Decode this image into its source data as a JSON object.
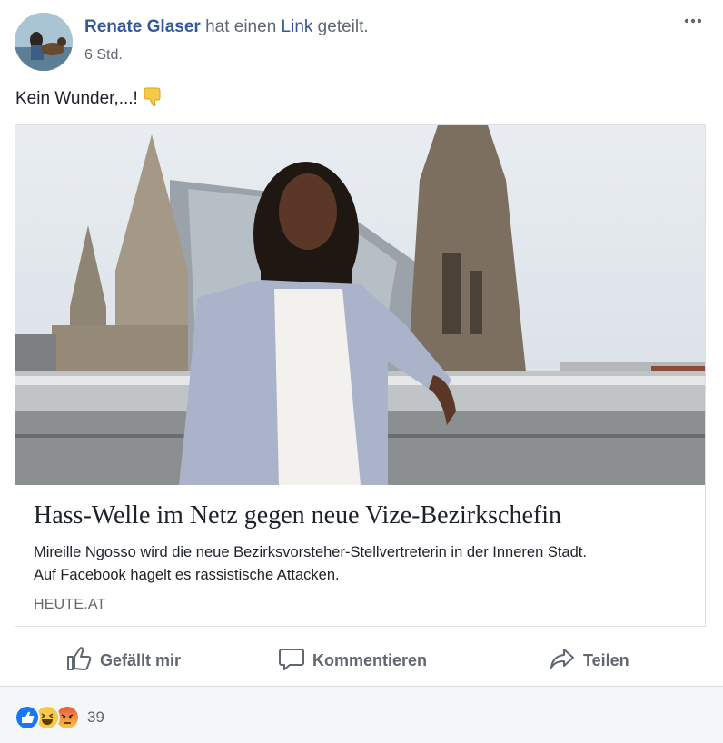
{
  "post": {
    "author": "Renate Glaser",
    "action_text_1": " hat einen ",
    "action_link": "Link",
    "action_text_2": " geteilt.",
    "time": "6 Std.",
    "message": "Kein Wunder,...!",
    "more_icon": "more-horizontal-icon"
  },
  "card": {
    "title": "Hass-Welle im Netz gegen neue Vize-Bezirkschefin",
    "description_line1": "Mireille Ngosso wird die neue Bezirksvorsteher-Stellvertreterin in der Inneren Stadt.",
    "description_line2": "Auf Facebook hagelt es rassistische Attacken.",
    "domain": "HEUTE.AT"
  },
  "actions": {
    "like": "Gefällt mir",
    "comment": "Kommentieren",
    "share": "Teilen"
  },
  "reactions": {
    "icons": [
      "like-icon",
      "haha-icon",
      "angry-icon"
    ],
    "count": "39"
  },
  "colors": {
    "link": "#365899",
    "secondary_text": "#606770",
    "like_blue": "#1877f2"
  }
}
